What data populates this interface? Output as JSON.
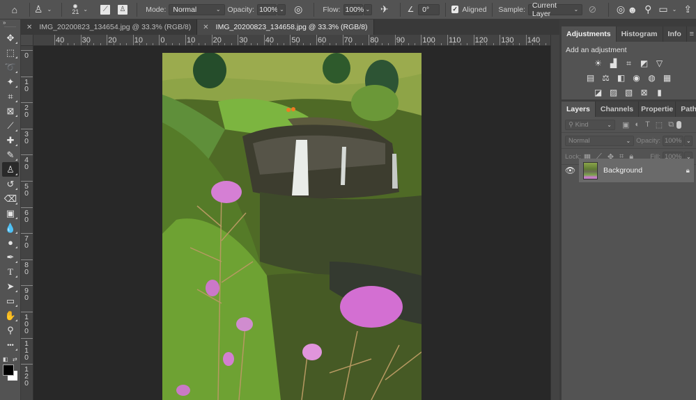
{
  "options_bar": {
    "home_icon": "home-icon",
    "tool_preset_icon": "clone-stamp-icon",
    "brush_size": "21",
    "mode_label": "Mode:",
    "mode_value": "Normal",
    "opacity_label": "Opacity:",
    "opacity_value": "100%",
    "flow_label": "Flow:",
    "flow_value": "100%",
    "angle_value": "0°",
    "aligned_label": "Aligned",
    "aligned_checked": true,
    "sample_label": "Sample:",
    "sample_value": "Current Layer"
  },
  "doc_tabs": [
    {
      "label": "IMG_20200823_134654.jpg @ 33.3% (RGB/8)",
      "active": false
    },
    {
      "label": "IMG_20200823_134658.jpg @ 33.3% (RGB/8)",
      "active": true
    }
  ],
  "ruler_h": [
    "40",
    "30",
    "20",
    "10",
    "0",
    "10",
    "20",
    "30",
    "40",
    "50",
    "60",
    "70",
    "80",
    "90",
    "100",
    "110",
    "120",
    "130",
    "140"
  ],
  "ruler_v": [
    "0",
    "10",
    "20",
    "30",
    "40",
    "50",
    "60",
    "70",
    "80",
    "90",
    "100",
    "110",
    "120"
  ],
  "tools": [
    {
      "name": "move-tool",
      "glyph": "✥"
    },
    {
      "name": "marquee-tool",
      "glyph": "⬚"
    },
    {
      "name": "lasso-tool",
      "glyph": "➰"
    },
    {
      "name": "magic-wand-tool",
      "glyph": "✦"
    },
    {
      "name": "crop-tool",
      "glyph": "⌗"
    },
    {
      "name": "frame-tool",
      "glyph": "⊠"
    },
    {
      "name": "eyedropper-tool",
      "glyph": "⟋"
    },
    {
      "name": "healing-brush-tool",
      "glyph": "✚"
    },
    {
      "name": "brush-tool",
      "glyph": "✎"
    },
    {
      "name": "clone-stamp-tool",
      "glyph": "♙",
      "active": true
    },
    {
      "name": "history-brush-tool",
      "glyph": "↺"
    },
    {
      "name": "eraser-tool",
      "glyph": "⌫"
    },
    {
      "name": "gradient-tool",
      "glyph": "▣"
    },
    {
      "name": "blur-tool",
      "glyph": "💧"
    },
    {
      "name": "dodge-tool",
      "glyph": "●"
    },
    {
      "name": "pen-tool",
      "glyph": "✒"
    },
    {
      "name": "type-tool",
      "glyph": "T"
    },
    {
      "name": "path-selection-tool",
      "glyph": "➤"
    },
    {
      "name": "rectangle-tool",
      "glyph": "▭"
    },
    {
      "name": "hand-tool",
      "glyph": "✋"
    },
    {
      "name": "zoom-tool",
      "glyph": "⚲"
    },
    {
      "name": "edit-toolbar",
      "glyph": "•••"
    }
  ],
  "colors": {
    "foreground": "#000000",
    "background": "#ffffff"
  },
  "adjustments_panel": {
    "tabs": [
      "Adjustments",
      "Histogram",
      "Info"
    ],
    "title": "Add an adjustment",
    "rows": [
      [
        "brightness-contrast-icon",
        "levels-icon",
        "curves-icon",
        "exposure-icon",
        "vibrance-icon"
      ],
      [
        "hue-saturation-icon",
        "color-balance-icon",
        "black-white-icon",
        "photo-filter-icon",
        "channel-mixer-icon",
        "color-lookup-icon"
      ],
      [
        "invert-icon",
        "posterize-icon",
        "threshold-icon",
        "selective-color-icon",
        "gradient-map-icon"
      ]
    ],
    "glyphs": [
      [
        "☀",
        "▟",
        "⌗",
        "◩",
        "▽"
      ],
      [
        "▤",
        "⚖",
        "◧",
        "◉",
        "◍",
        "▦"
      ],
      [
        "◪",
        "▨",
        "▧",
        "⊠",
        "▮"
      ]
    ]
  },
  "layers_panel": {
    "tabs": [
      "Layers",
      "Channels",
      "Propertie",
      "Paths"
    ],
    "filter_placeholder": "Kind",
    "blend_mode": "Normal",
    "opacity_label": "Opacity:",
    "opacity_value": "100%",
    "lock_label": "Lock:",
    "fill_label": "Fill:",
    "fill_value": "100%",
    "layers": [
      {
        "name": "Background",
        "visible": true,
        "locked": true
      }
    ]
  }
}
